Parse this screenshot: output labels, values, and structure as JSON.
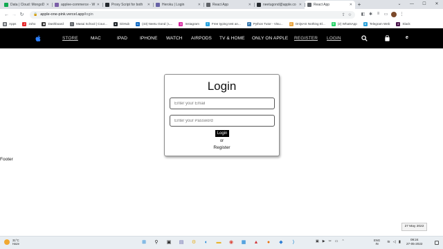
{
  "browser": {
    "tabs": [
      {
        "title": "Data | Cloud: MongoD",
        "color": "#13aa52"
      },
      {
        "title": "applee-commerce - W",
        "color": "#7b5ea7"
      },
      {
        "title": "Proxy Script for both",
        "color": "#24292e"
      },
      {
        "title": "Heroku | Login",
        "color": "#6762a6"
      },
      {
        "title": "React App",
        "color": "#5f6368"
      },
      {
        "title": "neetugond@apple.co",
        "color": "#24292e"
      },
      {
        "title": "React App",
        "color": "#5f6368"
      }
    ],
    "new_tab_label": "+",
    "url_host": "apple-one-pink.vercel.app",
    "url_path": "/login",
    "bookmarks": [
      {
        "label": "Apps",
        "color": "#5f6368",
        "glyph": "▦"
      },
      {
        "label": "zoho",
        "color": "#e42527",
        "glyph": "Z"
      },
      {
        "label": "Dashboard",
        "color": "#333333",
        "glyph": "◉"
      },
      {
        "label": "Masai School | Cour...",
        "color": "#5f6368",
        "glyph": "◇"
      },
      {
        "label": "GitHub",
        "color": "#24292e",
        "glyph": "●"
      },
      {
        "label": "(43) Neetu Gond | L...",
        "color": "#0a66c2",
        "glyph": "in"
      },
      {
        "label": "Instagram",
        "color": "#d6249f",
        "glyph": "◎"
      },
      {
        "label": "Free typing test an...",
        "color": "#2aa3e0",
        "glyph": "T"
      },
      {
        "label": "Python Tutor - Visu...",
        "color": "#3776ab",
        "glyph": "P"
      },
      {
        "label": "OnlyIAS Nothing El...",
        "color": "#e8a33d",
        "glyph": "O"
      },
      {
        "label": "(2) WhatsApp",
        "color": "#25d366",
        "glyph": "✆"
      },
      {
        "label": "Telegram Web",
        "color": "#2aa1da",
        "glyph": "➤"
      },
      {
        "label": "Slack",
        "color": "#4a154b",
        "glyph": "#"
      }
    ]
  },
  "site": {
    "nav": [
      {
        "label": "STORE",
        "underline": true
      },
      {
        "label": "MAC",
        "underline": false
      },
      {
        "label": "IPAD",
        "underline": false
      },
      {
        "label": "IPHONE",
        "underline": false
      },
      {
        "label": "WATCH",
        "underline": false
      },
      {
        "label": "AIRPODS",
        "underline": false
      },
      {
        "label": "TV & HOME",
        "underline": false
      },
      {
        "label": "ONLY ON APPLE",
        "underline": false
      },
      {
        "label": "REGISTER",
        "underline": true
      },
      {
        "label": "LOGIN",
        "underline": true
      }
    ],
    "nav_user_initial": "e",
    "login": {
      "title": "Login",
      "email_placeholder": "Enter your Email",
      "password_placeholder": "Enter your Password",
      "button_label": "Login",
      "or_text": "or",
      "register_link": "Register"
    },
    "footer_text": "Footer"
  },
  "os": {
    "date_tooltip": "27 May 2022",
    "weather_temp": "31°C",
    "weather_desc": "Haze",
    "lang_top": "ENG",
    "lang_bottom": "IN",
    "time": "09:24",
    "date": "27-05-2022"
  }
}
